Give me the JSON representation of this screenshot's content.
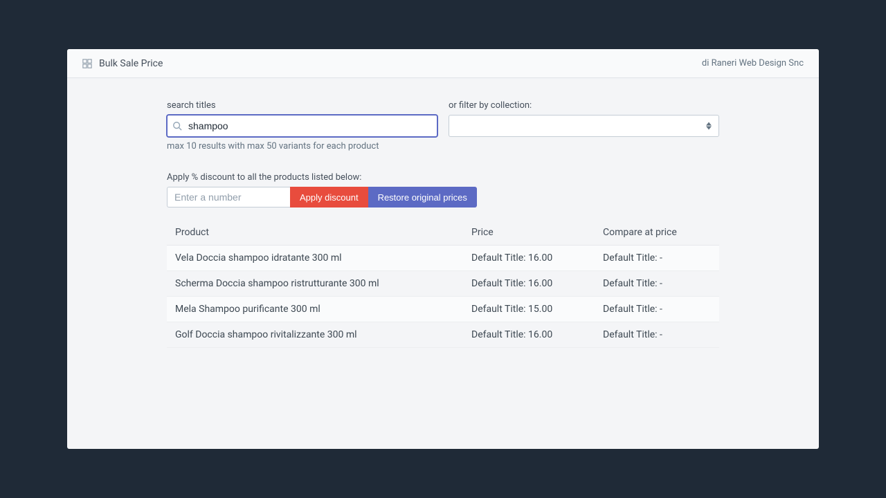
{
  "header": {
    "title": "Bulk Sale Price",
    "vendor": "di Raneri Web Design Snc"
  },
  "search": {
    "label": "search titles",
    "value": "shampoo",
    "hint": "max 10 results with max 50 variants for each product"
  },
  "collection_filter": {
    "label": "or filter by collection:",
    "value": ""
  },
  "discount": {
    "label": "Apply % discount to all the products listed below:",
    "placeholder": "Enter a number",
    "apply_label": "Apply discount",
    "restore_label": "Restore original prices"
  },
  "table": {
    "headers": {
      "product": "Product",
      "price": "Price",
      "compare": "Compare at price"
    },
    "rows": [
      {
        "product": "Vela Doccia shampoo idratante 300 ml",
        "price": "Default Title: 16.00",
        "compare": "Default Title: -"
      },
      {
        "product": "Scherma Doccia shampoo ristrutturante 300 ml",
        "price": "Default Title: 16.00",
        "compare": "Default Title: -"
      },
      {
        "product": "Mela Shampoo purificante 300 ml",
        "price": "Default Title: 15.00",
        "compare": "Default Title: -"
      },
      {
        "product": "Golf Doccia shampoo rivitalizzante 300 ml",
        "price": "Default Title: 16.00",
        "compare": "Default Title: -"
      }
    ]
  }
}
